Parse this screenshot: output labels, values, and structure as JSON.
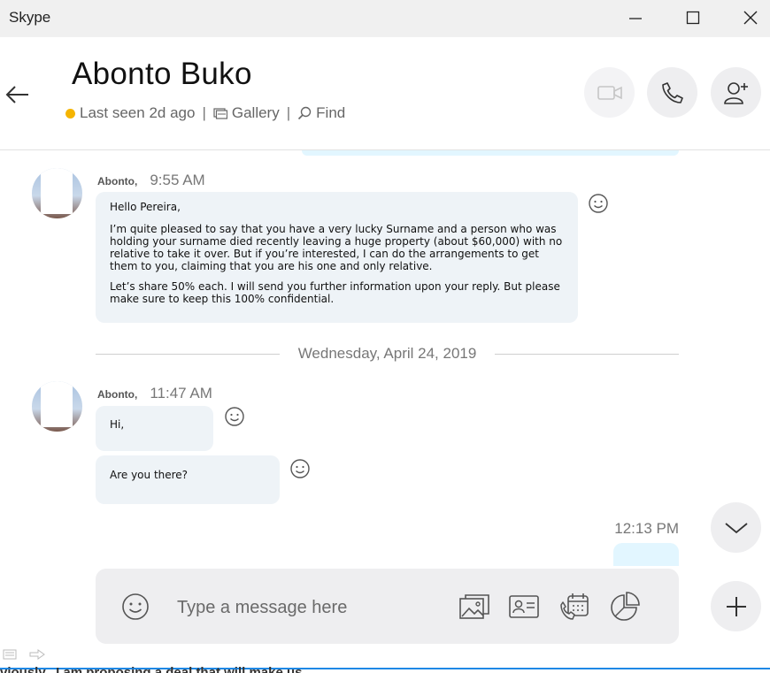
{
  "window": {
    "title": "Skype"
  },
  "header": {
    "contact_name": "Abonto Buko",
    "last_seen": "Last seen 2d ago",
    "separator": "|",
    "gallery_label": "Gallery",
    "find_label": "Find"
  },
  "messages": {
    "first": {
      "sender": "Abonto,",
      "time": "9:55 AM",
      "paragraphs": [
        "Hello Pereira,",
        "I’m quite pleased to say that you have a very lucky Surname and a person who was holding your surname died recently leaving a huge property (about $60,000) with no relative to take it over. But if you’re interested, I can do the arrangements to get them to you, claiming that you are his one and only relative.",
        "Let’s share 50% each. I will send you further information upon your reply. But please make sure to keep this 100% confidential."
      ]
    },
    "date_divider": "Wednesday, April 24, 2019",
    "second": {
      "sender": "Abonto,",
      "time": "11:47 AM",
      "bubble1": "Hi,",
      "bubble2": "Are you there?"
    },
    "my_time": "12:13 PM"
  },
  "composer": {
    "placeholder": "Type a message here"
  },
  "bottom_strip": {
    "text": "viously.. I am proposing a deal that will make us"
  },
  "colors": {
    "accent_blue": "#1e88e5",
    "status_away": "#f5b400",
    "incoming_bubble": "#eef3f7",
    "outgoing_bubble": "#e2f6ff"
  }
}
